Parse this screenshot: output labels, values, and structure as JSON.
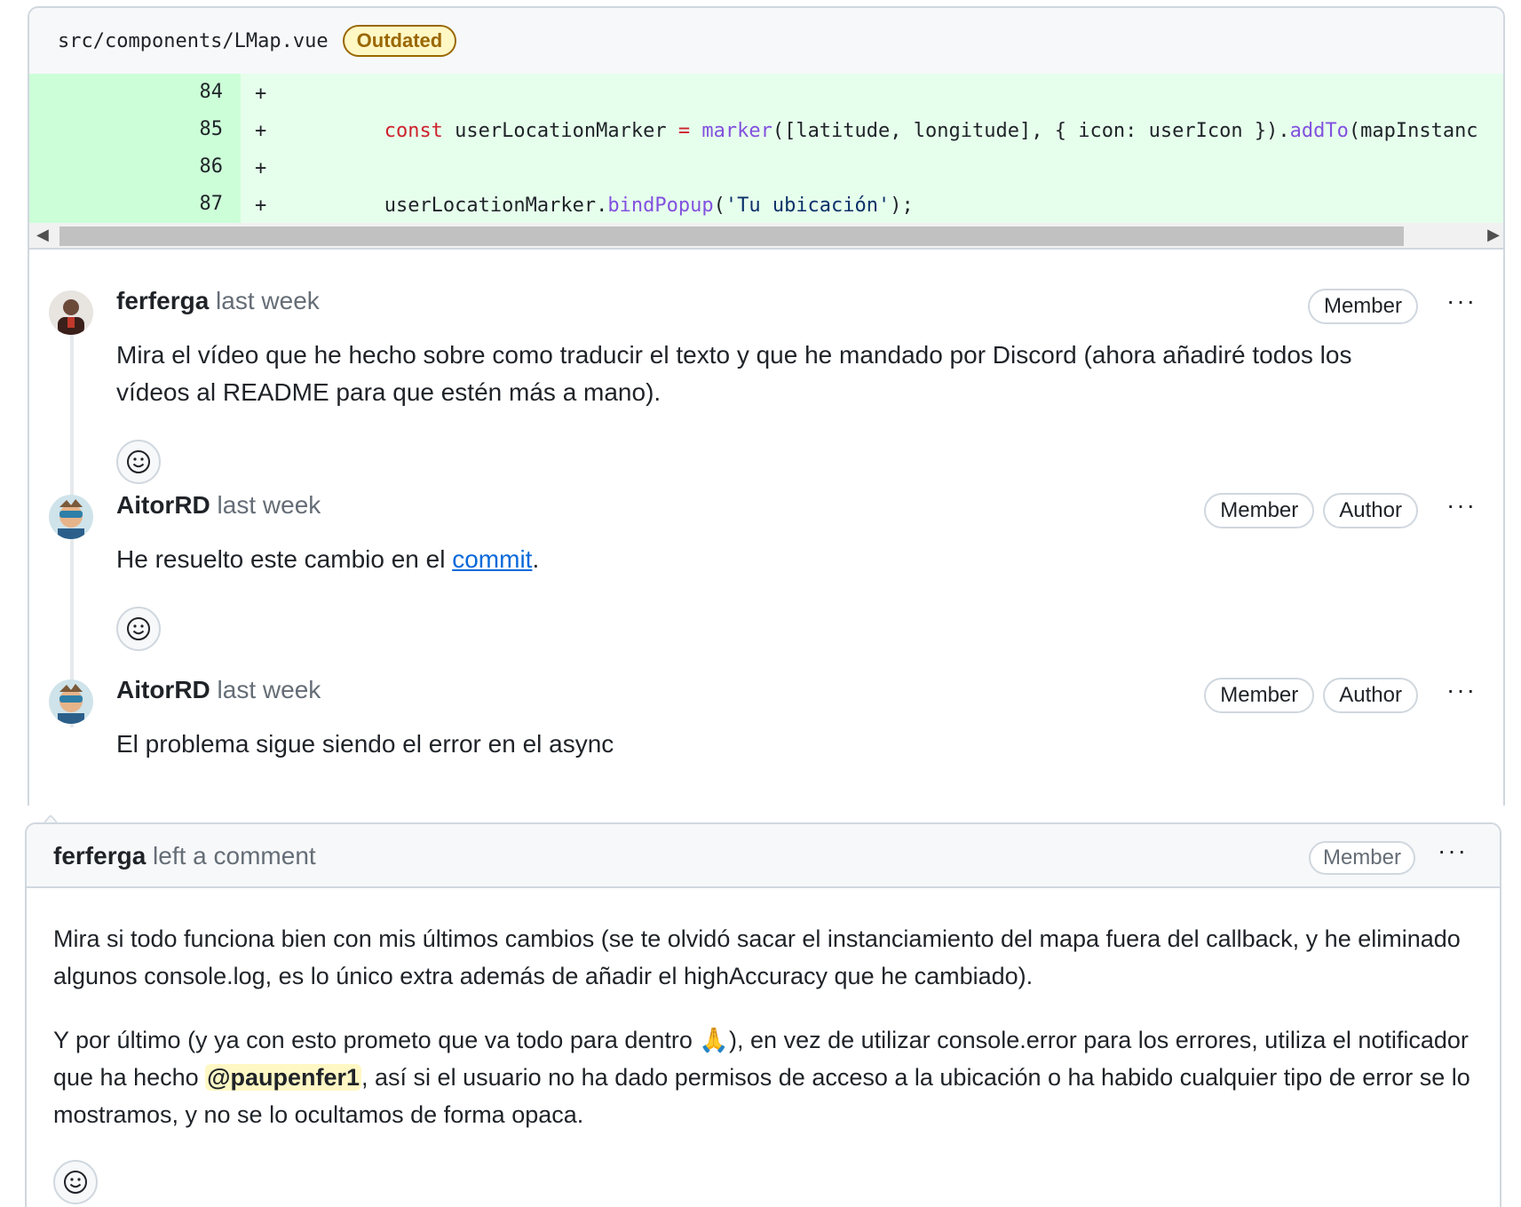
{
  "file": {
    "path": "src/components/LMap.vue",
    "status_badge": "Outdated"
  },
  "diff": {
    "lines": [
      {
        "number": "84",
        "sign": "+",
        "code": ""
      },
      {
        "number": "85",
        "sign": "+",
        "code": "const userLocationMarker = marker([latitude, longitude], { icon: userIcon }).addTo(mapInstanc"
      },
      {
        "number": "86",
        "sign": "+",
        "code": ""
      },
      {
        "number": "87",
        "sign": "+",
        "code": "userLocationMarker.bindPopup('Tu ubicación');"
      }
    ]
  },
  "thread": {
    "comments": [
      {
        "author": "ferferga",
        "time": "last week",
        "badges": [
          "Member"
        ],
        "body": "Mira el vídeo que he hecho sobre como traducir el texto y que he mandado por Discord (ahora añadiré todos los vídeos al README para que estén más a mano)."
      },
      {
        "author": "AitorRD",
        "time": "last week",
        "badges": [
          "Member",
          "Author"
        ],
        "body_prefix": "He resuelto este cambio en el ",
        "link": "commit",
        "body_suffix": "."
      },
      {
        "author": "AitorRD",
        "time": "last week",
        "badges": [
          "Member",
          "Author"
        ],
        "body": "El problema sigue siendo el error en el async"
      }
    ],
    "more_label": "···"
  },
  "timeline_comment": {
    "author": "ferferga",
    "action": "left a comment",
    "badge": "Member",
    "paragraph1": "Mira si todo funciona bien con mis últimos cambios (se te olvidó sacar el instanciamiento del mapa fuera del callback, y he eliminado algunos console.log, es lo único extra además de añadir el highAccuracy que he cambiado).",
    "paragraph2_part1": "Y por último (y ya con esto prometo que va todo para dentro ",
    "emoji": "🙏",
    "paragraph2_part2": "), en vez de utilizar console.error para los errores, utiliza el notificador que ha hecho ",
    "mention": "@paupenfer1",
    "paragraph2_part3": ", así si el usuario no ha dado permisos de acceso a la ubicación o ha habido cualquier tipo de error se lo mostramos, y no se lo ocultamos de forma opaca."
  },
  "colors": {
    "added_line_bg": "#e6ffec",
    "added_number_bg": "#ccffd8",
    "outdated": "#9a6700",
    "link": "#0969da"
  },
  "icons": [
    "smiley-icon",
    "kebab-icon",
    "scroll-left-icon",
    "scroll-right-icon"
  ]
}
